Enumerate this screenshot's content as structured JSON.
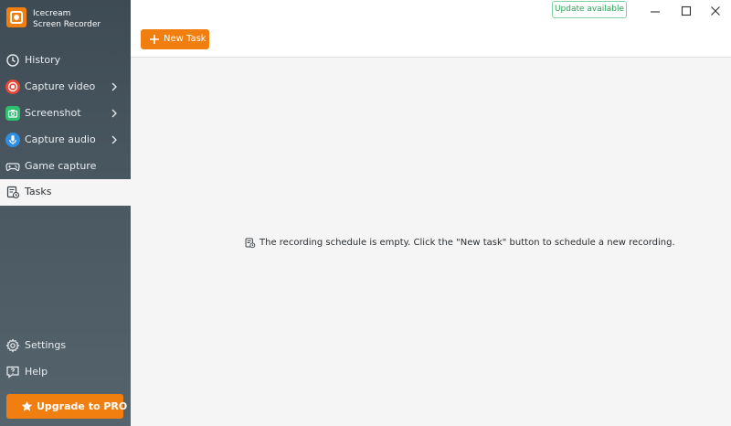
{
  "app": {
    "brand_line1": "Icecream",
    "brand_line2": "Screen Recorder",
    "accent_color": "#f17f0f"
  },
  "sidebar": {
    "items": [
      {
        "label": "History",
        "icon": "clock-icon",
        "has_submenu": false
      },
      {
        "label": "Capture video",
        "icon": "record-icon",
        "icon_color": "#e8473a",
        "has_submenu": true
      },
      {
        "label": "Screenshot",
        "icon": "camera-icon",
        "icon_color": "#2fbf71",
        "has_submenu": true
      },
      {
        "label": "Capture audio",
        "icon": "microphone-icon",
        "icon_color": "#2f8fe0",
        "has_submenu": true
      },
      {
        "label": "Game capture",
        "icon": "gamepad-icon",
        "has_submenu": false
      },
      {
        "label": "Tasks",
        "icon": "tasks-icon",
        "has_submenu": false,
        "active": true
      }
    ],
    "bottom_items": [
      {
        "label": "Settings",
        "icon": "gear-icon"
      },
      {
        "label": "Help",
        "icon": "help-icon"
      }
    ],
    "upgrade_label": "Upgrade to PRO"
  },
  "toolbar": {
    "new_task_label": "New Task",
    "update_label": "Update available"
  },
  "main": {
    "empty_message": "The recording schedule is empty. Click the \"New task\" button to schedule a new recording."
  }
}
